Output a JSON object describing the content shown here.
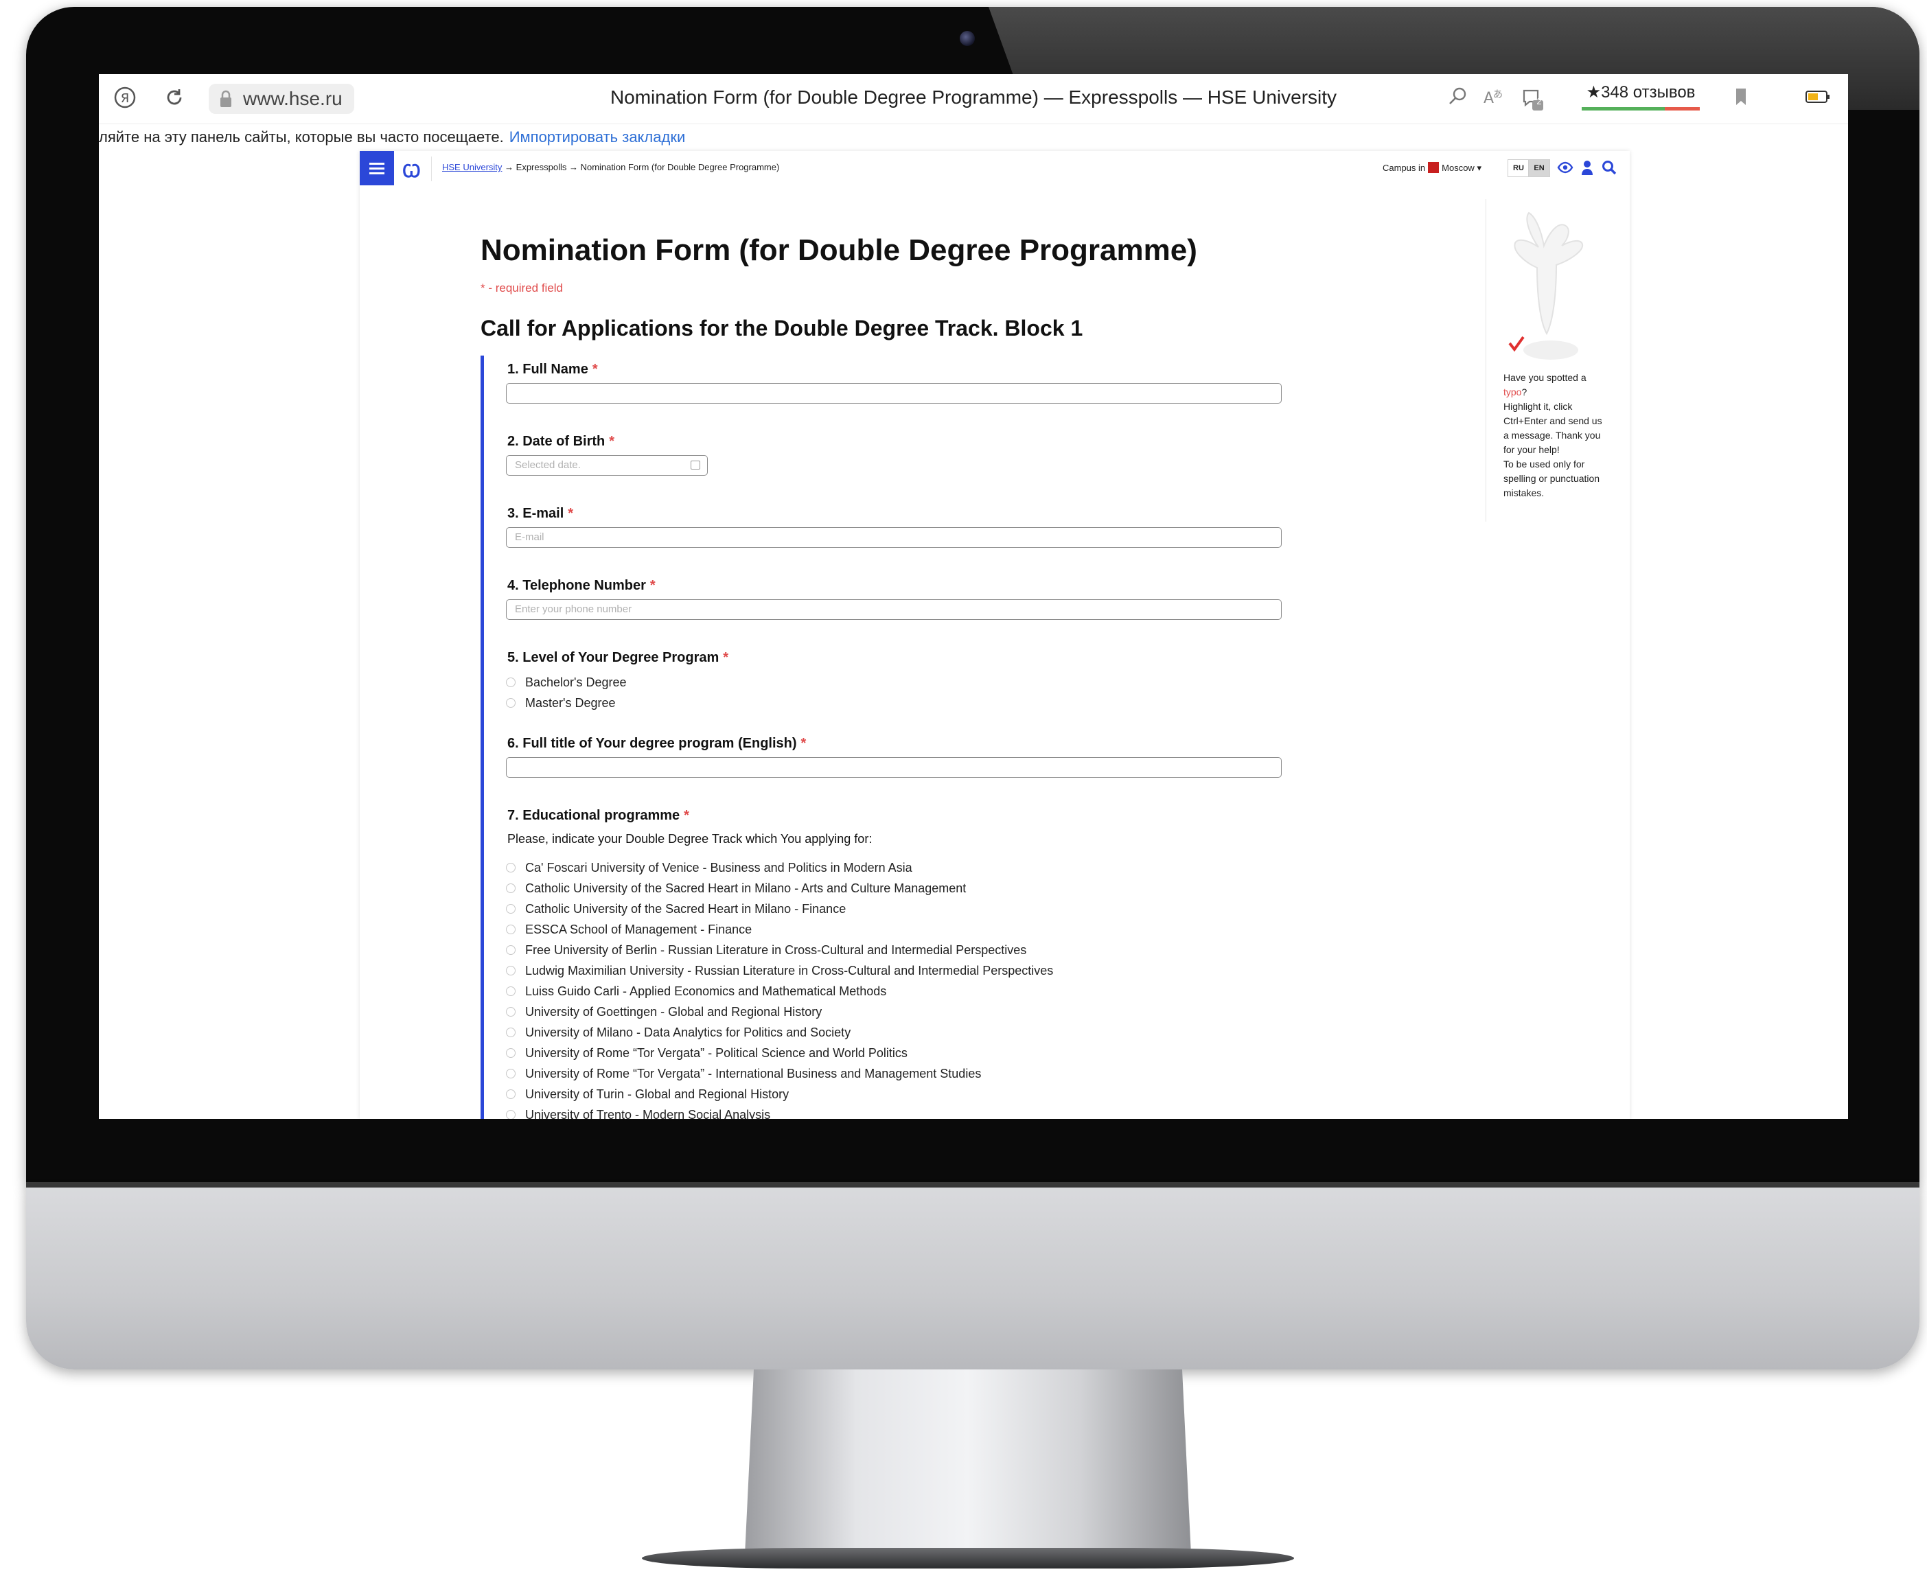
{
  "browser": {
    "url": "www.hse.ru",
    "tab_title": "Nomination Form (for Double Degree Programme) — Expresspolls — HSE University",
    "reviews": "★348 отзывов",
    "notification_count": "2",
    "bookmark_hint": "ляйте на эту панель сайты, которые вы часто посещаете.",
    "bookmark_link": "Импортировать закладки"
  },
  "header": {
    "breadcrumb_home": "HSE University",
    "breadcrumb_sep1": " → ",
    "breadcrumb_mid": "Expresspolls",
    "breadcrumb_sep2": " → ",
    "breadcrumb_current": "Nomination Form (for Double Degree Programme)",
    "campus_label": "Campus in",
    "campus_city": "Moscow",
    "lang_ru": "RU",
    "lang_en": "EN"
  },
  "form": {
    "title": "Nomination Form (for Double Degree Programme)",
    "required_note": "* - required field",
    "section_title": "Call for Applications for the Double Degree Track. Block 1",
    "required_mark": "*",
    "q1": "1. Full Name",
    "q2": "2. Date of Birth",
    "q2_placeholder": "Selected date.",
    "q3": "3. E-mail",
    "q3_placeholder": "E-mail",
    "q4": "4. Telephone Number",
    "q4_placeholder": "Enter your phone number",
    "q5": "5. Level of Your Degree Program",
    "q5_options": [
      "Bachelor's Degree",
      "Master's Degree"
    ],
    "q6": "6. Full title of Your degree program (English)",
    "q7": "7. Educational programme",
    "q7_help": "Please, indicate your Double Degree Track which You applying for:",
    "q7_options": [
      "Ca' Foscari University of Venice - Business and Politics in Modern Asia",
      "Catholic University of the Sacred Heart in Milano - Arts and Culture Management",
      "Catholic University of the Sacred Heart in Milano - Finance",
      "ESSCA School of Management - Finance",
      "Free University of Berlin - Russian Literature in Cross-Cultural and Intermedial Perspectives",
      "Ludwig Maximilian University - Russian Literature in Cross-Cultural and Intermedial Perspectives",
      "Luiss Guido Carli - Applied Economics and Mathematical Methods",
      "University of Goettingen - Global and Regional History",
      "University of Milano - Data Analytics for Politics and Society",
      "University of Rome “Tor Vergata” - Political Science and World Politics",
      "University of Rome “Tor Vergata” - International Business and Management Studies",
      "University of Turin - Global and Regional History",
      "University of Trento - Modern Social Analysis"
    ]
  },
  "typo_notice": {
    "line1": "Have you spotted a",
    "typo_word": "typo",
    "after_typo": "?",
    "body": "Highlight it, click Ctrl+Enter and send us a message. Thank you for your help!",
    "note": "To be used only for spelling or punctuation mistakes."
  }
}
